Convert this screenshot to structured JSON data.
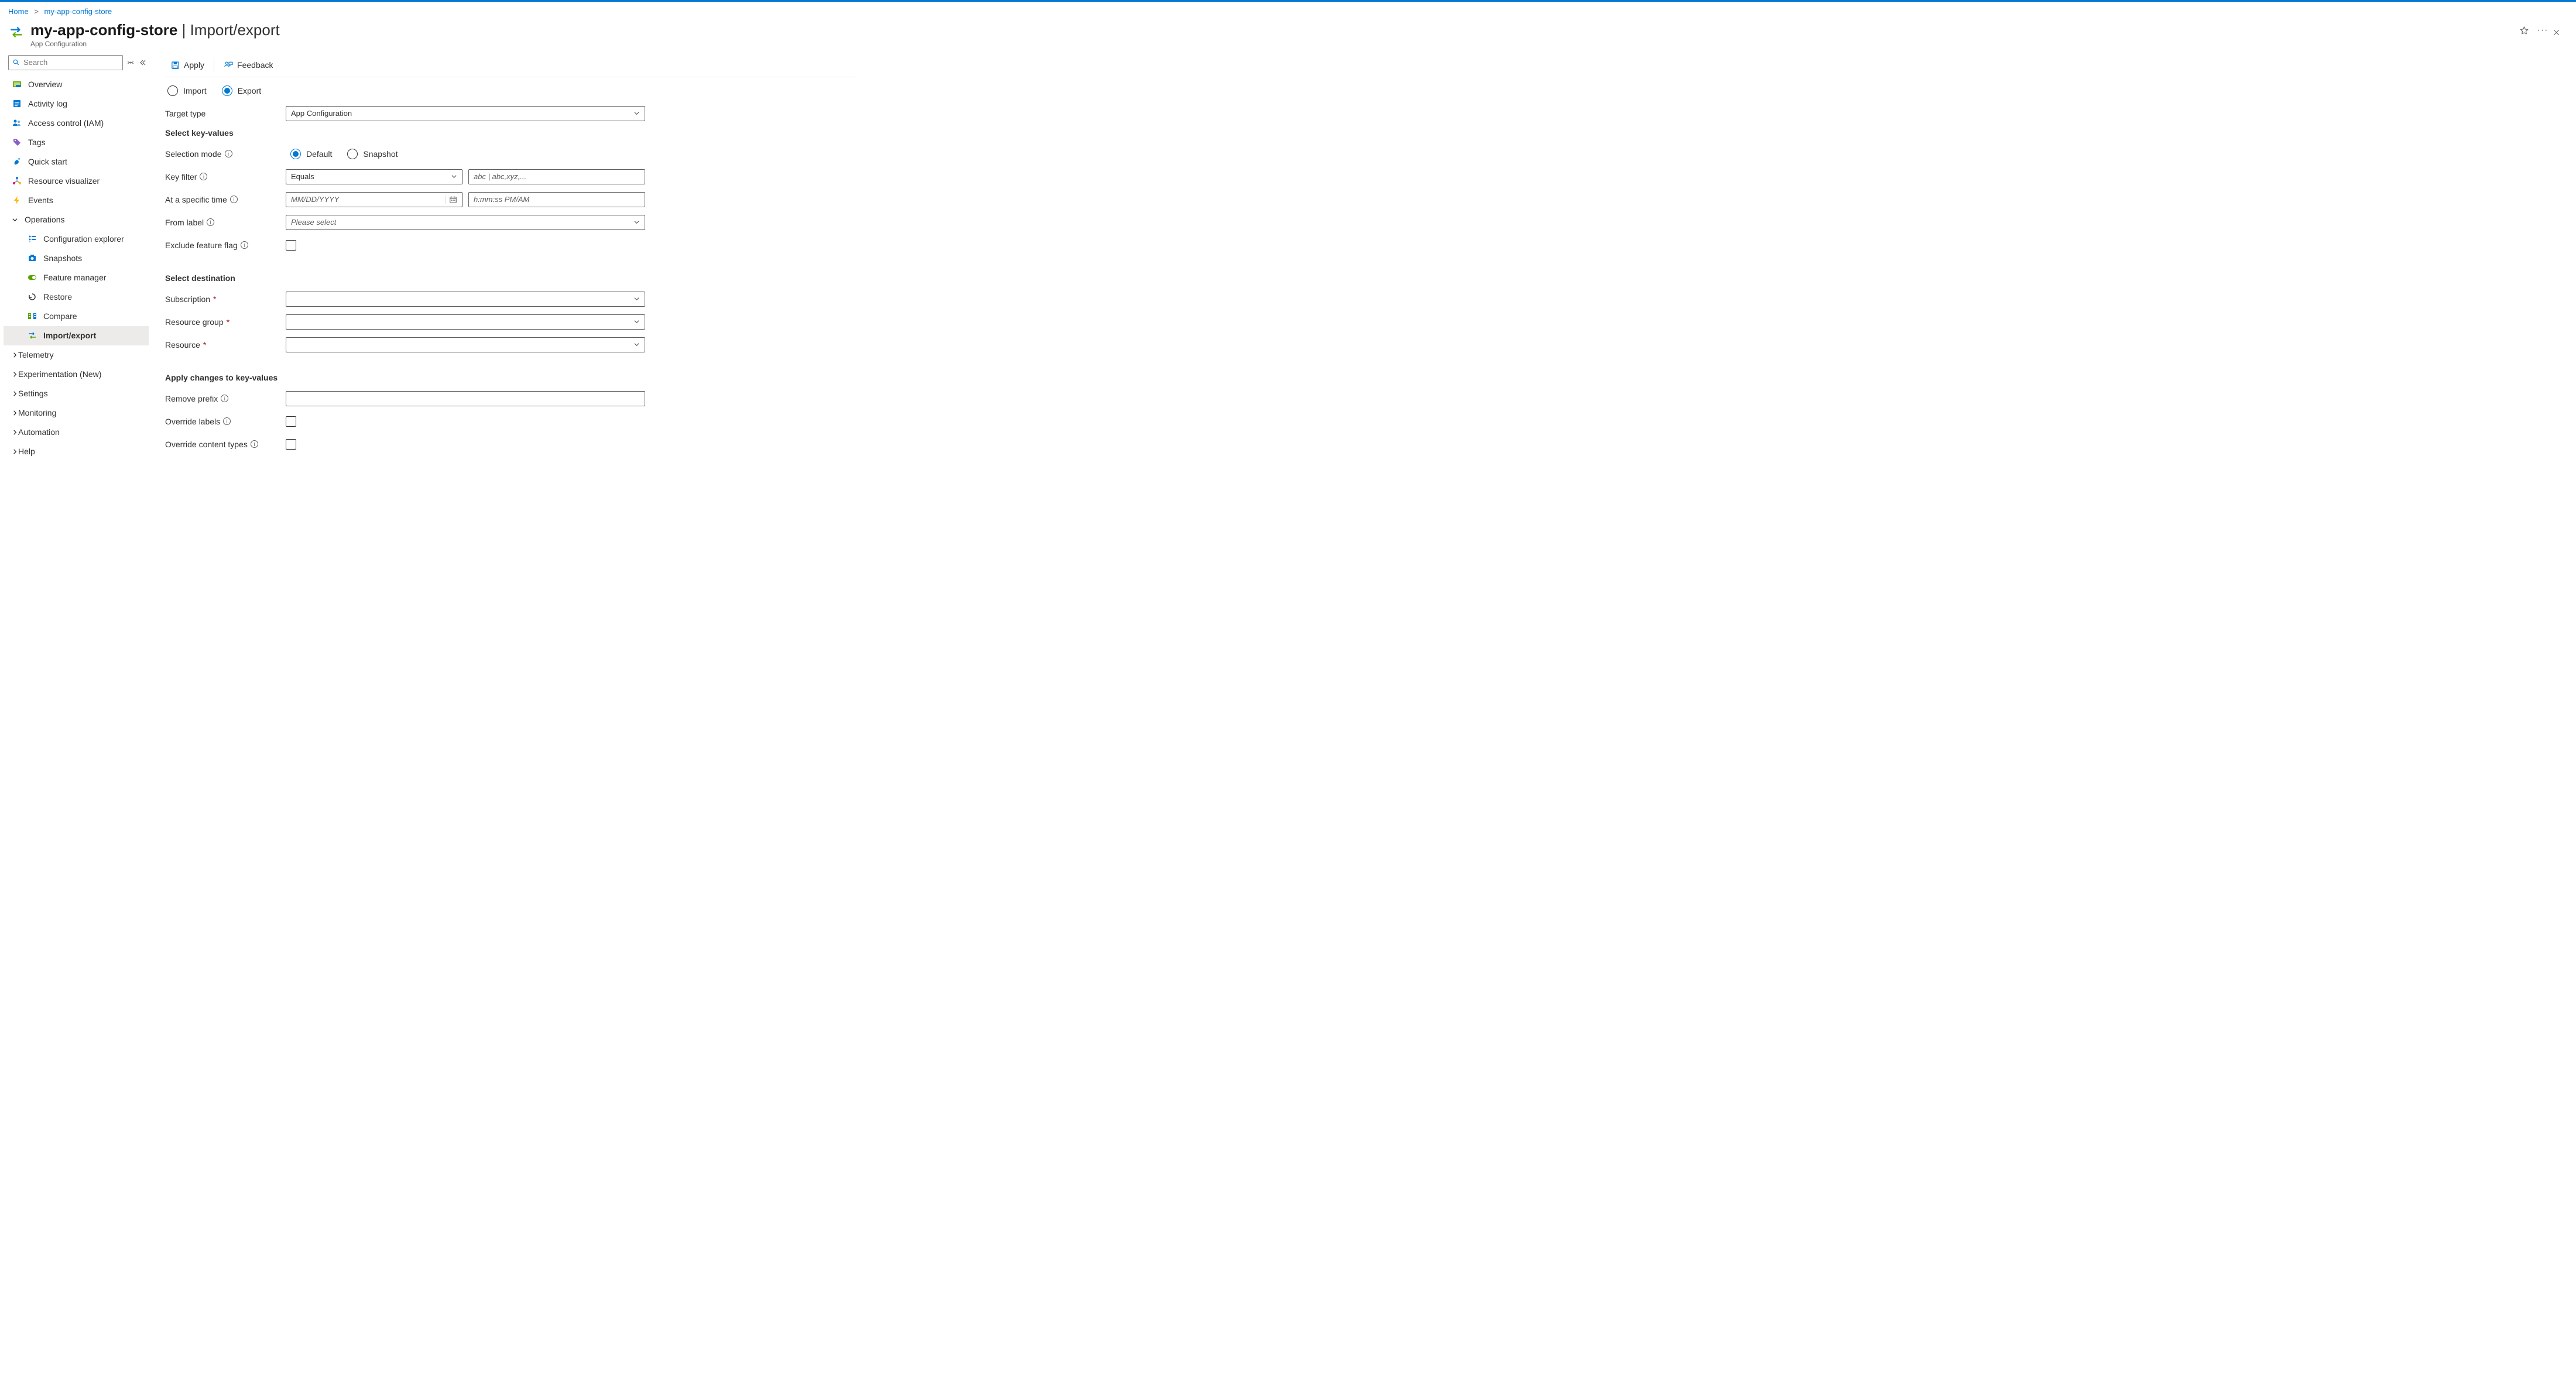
{
  "breadcrumb": {
    "home": "Home",
    "resource": "my-app-config-store"
  },
  "header": {
    "title": "my-app-config-store",
    "section": "Import/export",
    "subtitle": "App Configuration"
  },
  "sidebar": {
    "search_placeholder": "Search",
    "items": {
      "overview": "Overview",
      "activity": "Activity log",
      "iam": "Access control (IAM)",
      "tags": "Tags",
      "quickstart": "Quick start",
      "visualizer": "Resource visualizer",
      "events": "Events",
      "operations": "Operations",
      "config_explorer": "Configuration explorer",
      "snapshots": "Snapshots",
      "feature_manager": "Feature manager",
      "restore": "Restore",
      "compare": "Compare",
      "import_export": "Import/export",
      "telemetry": "Telemetry",
      "experimentation": "Experimentation (New)",
      "settings": "Settings",
      "monitoring": "Monitoring",
      "automation": "Automation",
      "help": "Help"
    }
  },
  "toolbar": {
    "apply": "Apply",
    "feedback": "Feedback"
  },
  "radios": {
    "import": "Import",
    "export": "Export"
  },
  "form": {
    "target_type_label": "Target type",
    "target_type_value": "App Configuration",
    "section_select": "Select key-values",
    "selection_mode": "Selection mode",
    "mode_default": "Default",
    "mode_snapshot": "Snapshot",
    "key_filter": "Key filter",
    "key_filter_value": "Equals",
    "key_filter_placeholder": "abc | abc,xyz,...",
    "specific_time": "At a specific time",
    "date_placeholder": "MM/DD/YYYY",
    "time_placeholder": "h:mm:ss PM/AM",
    "from_label": "From label",
    "from_label_placeholder": "Please select",
    "exclude_ff": "Exclude feature flag",
    "section_dest": "Select destination",
    "subscription": "Subscription",
    "resource_group": "Resource group",
    "resource": "Resource",
    "section_apply": "Apply changes to key-values",
    "remove_prefix": "Remove prefix",
    "override_labels": "Override labels",
    "override_ct": "Override content types"
  }
}
